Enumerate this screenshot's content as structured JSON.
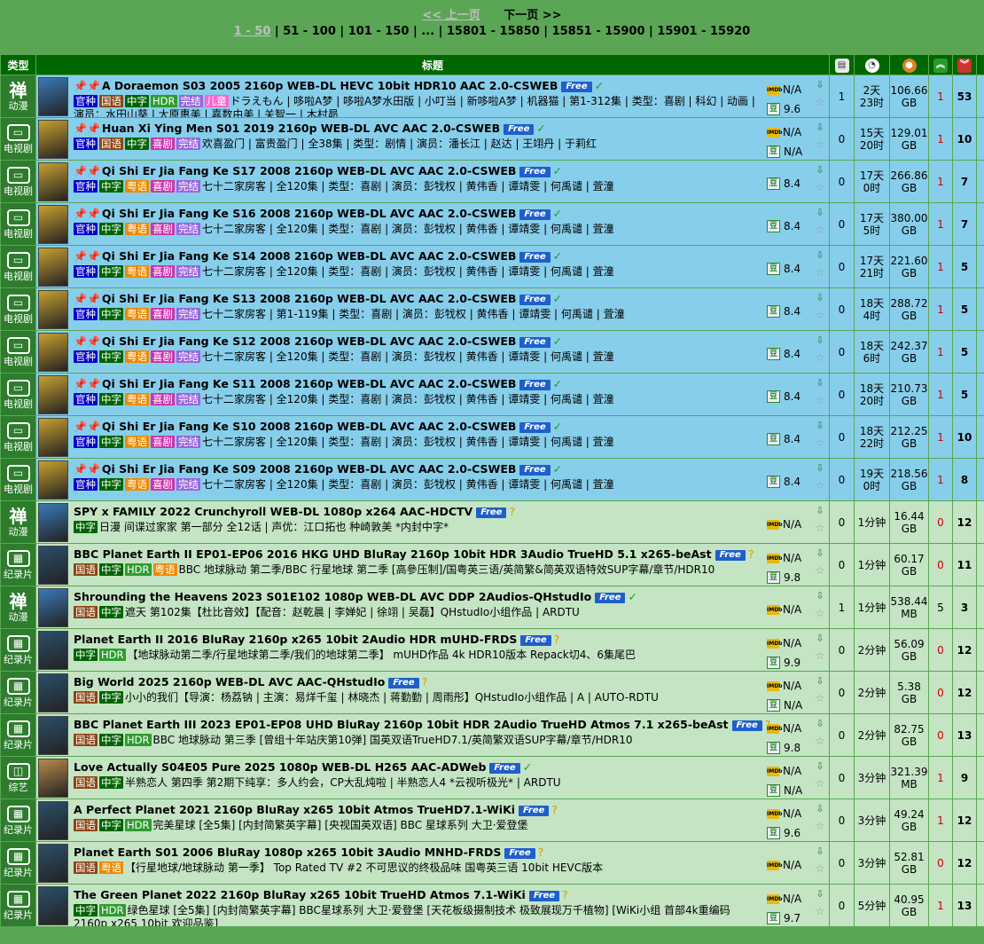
{
  "pager": {
    "prev": "<< 上一页",
    "next": "下一页 >>",
    "current": "1 - 50",
    "pages": [
      "51 - 100",
      "101 - 150",
      "...",
      "15801 - 15850",
      "15851 - 15900",
      "15901 - 15920"
    ]
  },
  "header": {
    "type": "类型",
    "title": "标题"
  },
  "rows": [
    {
      "cat": "动漫",
      "glyph": "禅",
      "bg": "blue",
      "pins": true,
      "title": "A Doraemon S03 2005 2160p WEB-DL HEVC 10bit HDR10 AAC 2.0-CSWEB",
      "flag": "check",
      "tags": [
        "官种",
        "国语",
        "中字",
        "HDR",
        "完结",
        "儿童"
      ],
      "sub": "ドラえもん | 哆啦A梦 | 哆啦A梦水田版 | 小叮当 | 新哆啦A梦 | 机器猫 | 第1-312集 | 类型：喜剧 | 科幻 | 动画 | 演员：水田山葵 | 大原惠美 | 嘉数由美 | 关智一 | 木村昴",
      "imdb": "N/A",
      "douban": "9.6",
      "comments": "1",
      "time": "2天\n23时",
      "size": "106.66\nGB",
      "seed": "1",
      "leech": "53"
    },
    {
      "cat": "电视剧",
      "glyph": "TV",
      "bg": "blue",
      "pins": true,
      "title": "Huan Xi Ying Men S01 2019 2160p WEB-DL AVC AAC 2.0-CSWEB",
      "flag": "check",
      "tags": [
        "官种",
        "国语",
        "中字",
        "喜剧",
        "完结"
      ],
      "sub": "欢喜盈门 | 富贵盈门 | 全38集 | 类型：剧情 | 演员：潘长江 | 赵达 | 王翊丹 | 于莉红",
      "imdb": "N/A",
      "douban": "N/A",
      "comments": "0",
      "time": "15天\n20时",
      "size": "129.01\nGB",
      "seed": "1",
      "leech": "10"
    },
    {
      "cat": "电视剧",
      "glyph": "TV",
      "bg": "blue",
      "pins": true,
      "title": "Qi Shi Er Jia Fang Ke S17 2008 2160p WEB-DL AVC AAC 2.0-CSWEB",
      "flag": "check",
      "tags": [
        "官种",
        "中字",
        "粤语",
        "喜剧",
        "完结"
      ],
      "sub": "七十二家房客 | 全120集 | 类型：喜剧 | 演员：彭牫权 | 黄伟香 | 谭靖雯 | 何禹谴 | 萓潼",
      "imdb": "",
      "douban": "8.4",
      "comments": "0",
      "time": "17天\n0时",
      "size": "266.86\nGB",
      "seed": "1",
      "leech": "7"
    },
    {
      "cat": "电视剧",
      "glyph": "TV",
      "bg": "blue",
      "pins": true,
      "title": "Qi Shi Er Jia Fang Ke S16 2008 2160p WEB-DL AVC AAC 2.0-CSWEB",
      "flag": "check",
      "tags": [
        "官种",
        "中字",
        "粤语",
        "喜剧",
        "完结"
      ],
      "sub": "七十二家房客 | 全120集 | 类型：喜剧 | 演员：彭牫权 | 黄伟香 | 谭靖雯 | 何禹谴 | 萓潼",
      "imdb": "",
      "douban": "8.4",
      "comments": "0",
      "time": "17天\n5时",
      "size": "380.00\nGB",
      "seed": "1",
      "leech": "7"
    },
    {
      "cat": "电视剧",
      "glyph": "TV",
      "bg": "blue",
      "pins": true,
      "title": "Qi Shi Er Jia Fang Ke S14 2008 2160p WEB-DL AVC AAC 2.0-CSWEB",
      "flag": "check",
      "tags": [
        "官种",
        "中字",
        "粤语",
        "喜剧",
        "完结"
      ],
      "sub": "七十二家房客 | 全120集 | 类型：喜剧 | 演员：彭牫权 | 黄伟香 | 谭靖雯 | 何禹谴 | 萓潼",
      "imdb": "",
      "douban": "8.4",
      "comments": "0",
      "time": "17天\n21时",
      "size": "221.60\nGB",
      "seed": "1",
      "leech": "5"
    },
    {
      "cat": "电视剧",
      "glyph": "TV",
      "bg": "blue",
      "pins": true,
      "title": "Qi Shi Er Jia Fang Ke S13 2008 2160p WEB-DL AVC AAC 2.0-CSWEB",
      "flag": "check",
      "tags": [
        "官种",
        "中字",
        "粤语",
        "喜剧",
        "完结"
      ],
      "sub": "七十二家房客 | 第1-119集 | 类型：喜剧 | 演员：彭牫权 | 黄伟香 | 谭靖雯 | 何禹谴 | 萓潼",
      "imdb": "",
      "douban": "8.4",
      "comments": "0",
      "time": "18天\n4时",
      "size": "288.72\nGB",
      "seed": "1",
      "leech": "5"
    },
    {
      "cat": "电视剧",
      "glyph": "TV",
      "bg": "blue",
      "pins": true,
      "title": "Qi Shi Er Jia Fang Ke S12 2008 2160p WEB-DL AVC AAC 2.0-CSWEB",
      "flag": "check",
      "tags": [
        "官种",
        "中字",
        "粤语",
        "喜剧",
        "完结"
      ],
      "sub": "七十二家房客 | 全120集 | 类型：喜剧 | 演员：彭牫权 | 黄伟香 | 谭靖雯 | 何禹谴 | 萓潼",
      "imdb": "",
      "douban": "8.4",
      "comments": "0",
      "time": "18天\n6时",
      "size": "242.37\nGB",
      "seed": "1",
      "leech": "5"
    },
    {
      "cat": "电视剧",
      "glyph": "TV",
      "bg": "blue",
      "pins": true,
      "title": "Qi Shi Er Jia Fang Ke S11 2008 2160p WEB-DL AVC AAC 2.0-CSWEB",
      "flag": "check",
      "tags": [
        "官种",
        "中字",
        "粤语",
        "喜剧",
        "完结"
      ],
      "sub": "七十二家房客 | 全120集 | 类型：喜剧 | 演员：彭牫权 | 黄伟香 | 谭靖雯 | 何禹谴 | 萓潼",
      "imdb": "",
      "douban": "8.4",
      "comments": "0",
      "time": "18天\n20时",
      "size": "210.73\nGB",
      "seed": "1",
      "leech": "5"
    },
    {
      "cat": "电视剧",
      "glyph": "TV",
      "bg": "blue",
      "pins": true,
      "title": "Qi Shi Er Jia Fang Ke S10 2008 2160p WEB-DL AVC AAC 2.0-CSWEB",
      "flag": "check",
      "tags": [
        "官种",
        "中字",
        "粤语",
        "喜剧",
        "完结"
      ],
      "sub": "七十二家房客 | 全120集 | 类型：喜剧 | 演员：彭牫权 | 黄伟香 | 谭靖雯 | 何禹谴 | 萓潼",
      "imdb": "",
      "douban": "8.4",
      "comments": "0",
      "time": "18天\n22时",
      "size": "212.25\nGB",
      "seed": "1",
      "leech": "10"
    },
    {
      "cat": "电视剧",
      "glyph": "TV",
      "bg": "blue",
      "pins": true,
      "title": "Qi Shi Er Jia Fang Ke S09 2008 2160p WEB-DL AVC AAC 2.0-CSWEB",
      "flag": "check",
      "tags": [
        "官种",
        "中字",
        "粤语",
        "喜剧",
        "完结"
      ],
      "sub": "七十二家房客 | 全120集 | 类型：喜剧 | 演员：彭牫权 | 黄伟香 | 谭靖雯 | 何禹谴 | 萓潼",
      "imdb": "",
      "douban": "8.4",
      "comments": "0",
      "time": "19天\n0时",
      "size": "218.56\nGB",
      "seed": "1",
      "leech": "8"
    },
    {
      "cat": "动漫",
      "glyph": "禅",
      "bg": "green",
      "pins": false,
      "title": "SPY x FAMILY 2022 Crunchyroll WEB-DL 1080p x264 AAC-HDCTV",
      "flag": "q",
      "tags": [
        "中字"
      ],
      "sub": "日漫 间谍过家家 第一部分 全12话 | 声优：江口拓也 种崎敦美 *内封中字*",
      "imdb": "N/A",
      "douban": "",
      "comments": "0",
      "time": "1分钟",
      "size": "16.44\nGB",
      "seed": "0",
      "leech": "12"
    },
    {
      "cat": "纪录片",
      "glyph": "BBC",
      "bg": "green",
      "pins": false,
      "title": "BBC Planet Earth II EP01-EP06 2016 HKG UHD BluRay 2160p 10bit HDR 3Audio TrueHD 5.1 x265-beAst",
      "flag": "q",
      "tags": [
        "国语",
        "中字",
        "HDR",
        "粤语"
      ],
      "sub": "BBC 地球脉动 第二季/BBC 行星地球 第二季 [高參压制]/国粤英三语/英简繁&简英双语特效SUP字幕/章节/HDR10",
      "imdb": "N/A",
      "douban": "9.8",
      "comments": "0",
      "time": "1分钟",
      "size": "60.17\nGB",
      "seed": "0",
      "leech": "11"
    },
    {
      "cat": "动漫",
      "glyph": "禅",
      "bg": "green",
      "pins": false,
      "title": "Shrounding the Heavens 2023 S01E102 1080p WEB-DL AVC DDP 2Audios-QHstudIo",
      "flag": "check",
      "tags": [
        "国语",
        "中字"
      ],
      "sub": "遮天 第102集【杜比音效】【配音：赵乾晨 | 李婵妃 | 徐翊 | 吴磊】QHstudIo小组作品 | ARDTU",
      "imdb": "N/A",
      "douban": "",
      "comments": "1",
      "time": "1分钟",
      "size": "538.44\nMB",
      "seed": "5",
      "leech": "3"
    },
    {
      "cat": "纪录片",
      "glyph": "BBC",
      "bg": "green",
      "pins": false,
      "title": "Planet Earth II 2016 BluRay 2160p x265 10bit 2Audio HDR mUHD-FRDS",
      "flag": "q",
      "tags": [
        "中字",
        "HDR"
      ],
      "sub": "【地球脉动第二季/行星地球第二季/我们的地球第二季】 mUHD作品 4k HDR10版本 Repack切4、6集尾巴",
      "imdb": "N/A",
      "douban": "9.9",
      "comments": "0",
      "time": "2分钟",
      "size": "56.09\nGB",
      "seed": "0",
      "leech": "12"
    },
    {
      "cat": "纪录片",
      "glyph": "BBC",
      "bg": "green",
      "pins": false,
      "title": "Big World 2025 2160p WEB-DL AVC AAC-QHstudIo",
      "flag": "q",
      "tags": [
        "国语",
        "中字"
      ],
      "sub": "小小的我们【导演：杨荔钠 | 主演：易烊千玺 | 林晓杰 | 蒋勤勤 | 周雨彤】QHstudIo小组作品 | A | AUTO-RDTU",
      "imdb": "N/A",
      "douban": "N/A",
      "comments": "0",
      "time": "2分钟",
      "size": "5.38\nGB",
      "seed": "0",
      "leech": "12"
    },
    {
      "cat": "纪录片",
      "glyph": "BBC",
      "bg": "green",
      "pins": false,
      "title": "BBC Planet Earth III 2023 EP01-EP08 UHD BluRay 2160p 10bit HDR 2Audio TrueHD Atmos 7.1 x265-beAst",
      "flag": "q",
      "tags": [
        "国语",
        "中字",
        "HDR"
      ],
      "sub": "BBC 地球脉动 第三季 [曾组十年站庆第10弹] 国英双语TrueHD7.1/英简繁双语SUP字幕/章节/HDR10",
      "imdb": "N/A",
      "douban": "9.8",
      "comments": "0",
      "time": "2分钟",
      "size": "82.75\nGB",
      "seed": "0",
      "leech": "13"
    },
    {
      "cat": "综艺",
      "glyph": "综",
      "bg": "green",
      "pins": false,
      "title": "Love Actually S04E05 Pure 2025 1080p WEB-DL H265 AAC-ADWeb",
      "flag": "check",
      "tags": [
        "国语",
        "中字"
      ],
      "sub": "半熟恋人 第四季 第2期下纯享：多人约会，CP大乱炖啦 | 半熟恋人4 *云视听极光* | ARDTU",
      "imdb": "N/A",
      "douban": "N/A",
      "comments": "0",
      "time": "3分钟",
      "size": "321.39\nMB",
      "seed": "1",
      "leech": "9"
    },
    {
      "cat": "纪录片",
      "glyph": "BBC",
      "bg": "green",
      "pins": false,
      "title": "A Perfect Planet 2021 2160p BluRay x265 10bit Atmos TrueHD7.1-WiKi",
      "flag": "q",
      "tags": [
        "国语",
        "中字",
        "HDR"
      ],
      "sub": "完美星球 [全5集] [内封简繁英字幕] [央视国英双语] BBC 星球系列 大卫·爱登堡",
      "imdb": "N/A",
      "douban": "9.6",
      "comments": "0",
      "time": "3分钟",
      "size": "49.24\nGB",
      "seed": "1",
      "leech": "12"
    },
    {
      "cat": "纪录片",
      "glyph": "BBC",
      "bg": "green",
      "pins": false,
      "title": "Planet Earth S01 2006 BluRay 1080p x265 10bit 3Audio MNHD-FRDS",
      "flag": "q",
      "tags": [
        "国语",
        "粤语"
      ],
      "sub": "【行星地球/地球脉动 第一季】 Top Rated TV #2 不可思议的终极品味 国粤英三语 10bit HEVC版本",
      "imdb": "N/A",
      "douban": "",
      "comments": "0",
      "time": "3分钟",
      "size": "52.81\nGB",
      "seed": "0",
      "leech": "12"
    },
    {
      "cat": "纪录片",
      "glyph": "BBC",
      "bg": "green",
      "pins": false,
      "title": "The Green Planet 2022 2160p BluRay x265 10bit TrueHD Atmos 7.1-WiKi",
      "flag": "q",
      "tags": [
        "中字",
        "HDR"
      ],
      "sub": "绿色星球 [全5集] [内封简繁英字幕] BBC星球系列 大卫·爱登堡 [天花板级摄制技术 极致展现万千植物] [WiKi小组 首部4k重编码 2160p x265 10bit 欢迎品鉴]",
      "imdb": "N/A",
      "douban": "9.7",
      "comments": "0",
      "time": "5分钟",
      "size": "40.95\nGB",
      "seed": "1",
      "leech": "13"
    }
  ],
  "colors": {
    "page_bg": "#5aa655",
    "header_bg": "#006600",
    "row_pinned": "#87ceeb",
    "row_normal": "#c4e4c4",
    "free": "#1e5fcc"
  }
}
